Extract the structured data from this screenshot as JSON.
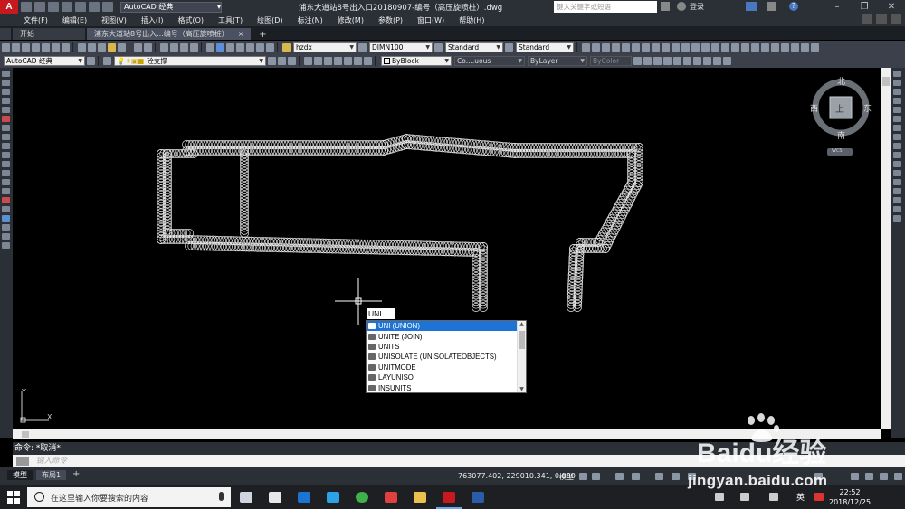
{
  "app": {
    "logo_letter": "A",
    "workspace": "AutoCAD 经典",
    "title": "浦东大道站8号出入口20180907-编号（高压旋喷桩）.dwg",
    "search_placeholder": "键入关键字或短语",
    "login": "登录"
  },
  "menu": [
    "文件(F)",
    "编辑(E)",
    "视图(V)",
    "插入(I)",
    "格式(O)",
    "工具(T)",
    "绘图(D)",
    "标注(N)",
    "修改(M)",
    "参数(P)",
    "窗口(W)",
    "帮助(H)"
  ],
  "tabs": {
    "start": "开始",
    "active": "浦东大道站8号出入...编号（高压旋喷桩）",
    "close": "×",
    "add": "+"
  },
  "toolbar1": {
    "text_style": "hzdx",
    "dim_style": "DIMN100",
    "table_style": "Standard",
    "multileader_style": "Standard"
  },
  "toolbar2": {
    "workspace": "AutoCAD 经典",
    "layer": "砼支撑",
    "color": "ByBlock",
    "linetype": "Co....uous",
    "lineweight": "ByLayer",
    "plotstyle": "ByColor"
  },
  "viewcube": {
    "north": "北",
    "south": "南",
    "east": "东",
    "west": "西",
    "top": "上",
    "wcs": "WCS"
  },
  "ucs": {
    "x": "X",
    "y": "Y"
  },
  "command": {
    "input_value": "UNI",
    "history": "命令: *取消*",
    "placeholder": "键入命令"
  },
  "autocomplete": [
    {
      "label": "UNI (UNION)",
      "icon": "union-icon",
      "selected": true
    },
    {
      "label": "UNITE (JOIN)",
      "icon": "join-icon",
      "selected": false
    },
    {
      "label": "UNITS",
      "icon": "units-icon",
      "selected": false
    },
    {
      "label": "UNISOLATE (UNISOLATEOBJECTS)",
      "icon": "unisolate-icon",
      "selected": false
    },
    {
      "label": "UNITMODE",
      "icon": "sysvar-icon",
      "selected": false
    },
    {
      "label": "LAYUNISO",
      "icon": "layer-icon",
      "selected": false
    },
    {
      "label": "INSUNITS",
      "icon": "sysvar-icon",
      "selected": false
    }
  ],
  "layout_tabs": {
    "model": "模型",
    "layout1": "布局1",
    "add": "+"
  },
  "status": {
    "coords": "763077.402, 229010.341, 0.000",
    "model": "模型"
  },
  "taskbar": {
    "search_placeholder": "在这里输入你要搜索的内容",
    "lang": "英",
    "time": "22:52",
    "date": "2018/12/25"
  },
  "watermark": {
    "brand": "Baidu经验",
    "url": "jingyan.baidu.com"
  },
  "colors": {
    "canvas": "#000000",
    "ui_dark": "#2b2f36",
    "selection": "#1e73d6",
    "autocad_red": "#c8191e"
  }
}
